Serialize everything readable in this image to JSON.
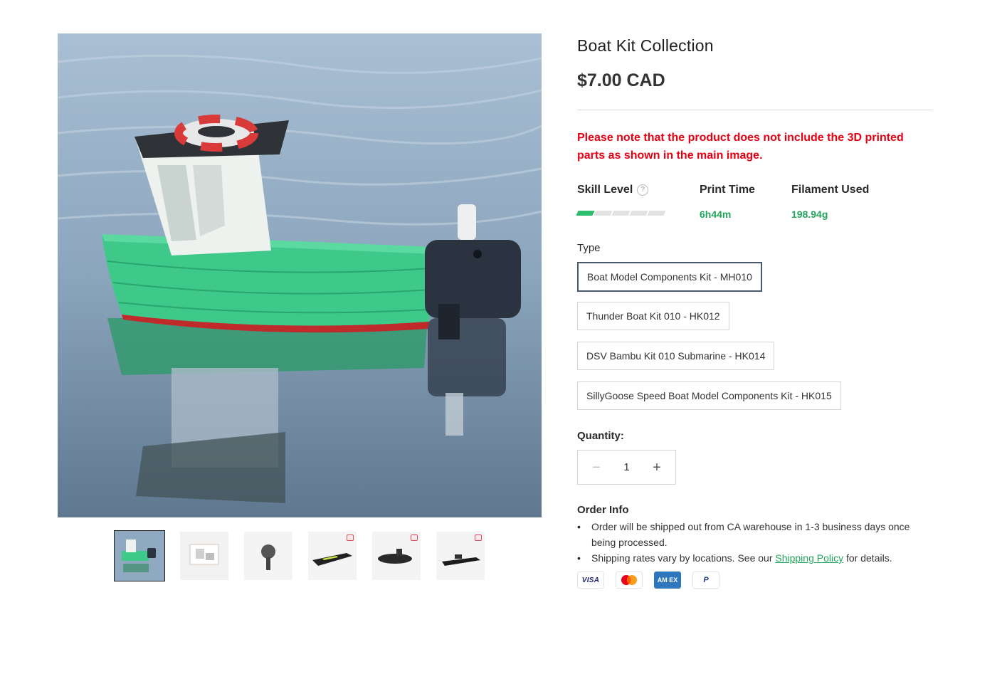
{
  "gallery": {
    "main_image_alt": "",
    "thumbnail_count": 6
  },
  "product": {
    "title": "Boat Kit Collection",
    "price": "$7.00 CAD",
    "notice": "Please note that the product does not include the 3D printed parts as shown in the main image."
  },
  "stats": {
    "skill_label": "Skill Level",
    "skill_level": 1,
    "skill_max": 5,
    "print_time_label": "Print Time",
    "print_time_value": "6h44m",
    "filament_label": "Filament Used",
    "filament_value": "198.94g"
  },
  "type_section": {
    "label": "Type",
    "options": [
      "Boat Model Components Kit - MH010",
      "Thunder Boat Kit 010 - HK012",
      "DSV Bambu Kit 010 Submarine - HK014",
      "SillyGoose Speed Boat Model Components Kit - HK015"
    ],
    "selected_index": 0
  },
  "quantity": {
    "label": "Quantity:",
    "value": "1",
    "minus": "−",
    "plus": "+"
  },
  "order_info": {
    "title": "Order Info",
    "line1": "Order will be shipped out from CA warehouse in 1-3 business days once being processed.",
    "line2_before": "Shipping rates vary by locations. See our ",
    "line2_link": "Shipping Policy",
    "line2_after": " for details."
  },
  "payments": {
    "visa": "VISA",
    "amex": "AM EX",
    "paypal": "P"
  },
  "colors": {
    "accent_green": "#22a55a",
    "notice_red": "#e60012",
    "boat_green": "#3ec98a"
  }
}
